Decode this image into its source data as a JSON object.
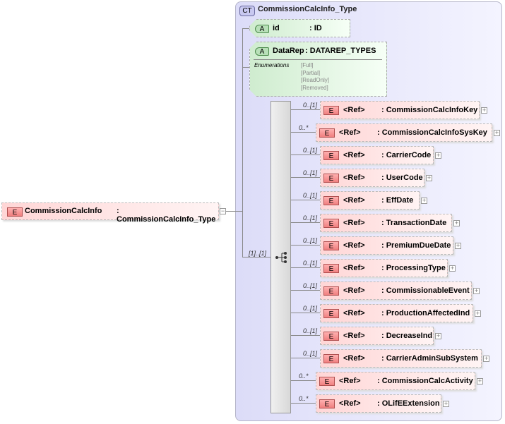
{
  "root": {
    "badge": "E",
    "name": "CommissionCalcInfo",
    "type": ": CommissionCalcInfo_Type",
    "collapse_icon": "minus-box-icon"
  },
  "complex_type": {
    "badge": "CT",
    "name": "CommissionCalcInfo_Type"
  },
  "attributes": [
    {
      "badge": "A",
      "name": "id",
      "type": ": ID"
    },
    {
      "badge": "A",
      "name": "DataRep",
      "type": ": DATAREP_TYPES",
      "enum_label": "Enumerations",
      "enumerations": [
        "[Full]",
        "[Partial]",
        "[ReadOnly]",
        "[Removed]"
      ]
    }
  ],
  "sequence": {
    "cardinality": "[1]..[1]",
    "icon": "sequence-icon"
  },
  "elements": [
    {
      "card": "0..[1]",
      "ref": "<Ref>",
      "type": ": CommissionCalcInfoKey"
    },
    {
      "card": "0..*",
      "ref": "<Ref>",
      "type": ": CommissionCalcInfoSysKey"
    },
    {
      "card": "0..[1]",
      "ref": "<Ref>",
      "type": ": CarrierCode"
    },
    {
      "card": "0..[1]",
      "ref": "<Ref>",
      "type": ": UserCode"
    },
    {
      "card": "0..[1]",
      "ref": "<Ref>",
      "type": ": EffDate"
    },
    {
      "card": "0..[1]",
      "ref": "<Ref>",
      "type": ": TransactionDate"
    },
    {
      "card": "0..[1]",
      "ref": "<Ref>",
      "type": ": PremiumDueDate"
    },
    {
      "card": "0..[1]",
      "ref": "<Ref>",
      "type": ": ProcessingType"
    },
    {
      "card": "0..[1]",
      "ref": "<Ref>",
      "type": ": CommissionableEvent"
    },
    {
      "card": "0..[1]",
      "ref": "<Ref>",
      "type": ": ProductionAffectedInd"
    },
    {
      "card": "0..[1]",
      "ref": "<Ref>",
      "type": ": DecreaseInd"
    },
    {
      "card": "0..[1]",
      "ref": "<Ref>",
      "type": ": CarrierAdminSubSystem"
    },
    {
      "card": "0..*",
      "ref": "<Ref>",
      "type": ": CommissionCalcActivity"
    },
    {
      "card": "0..*",
      "ref": "<Ref>",
      "type": ": OLifEExtension"
    }
  ]
}
